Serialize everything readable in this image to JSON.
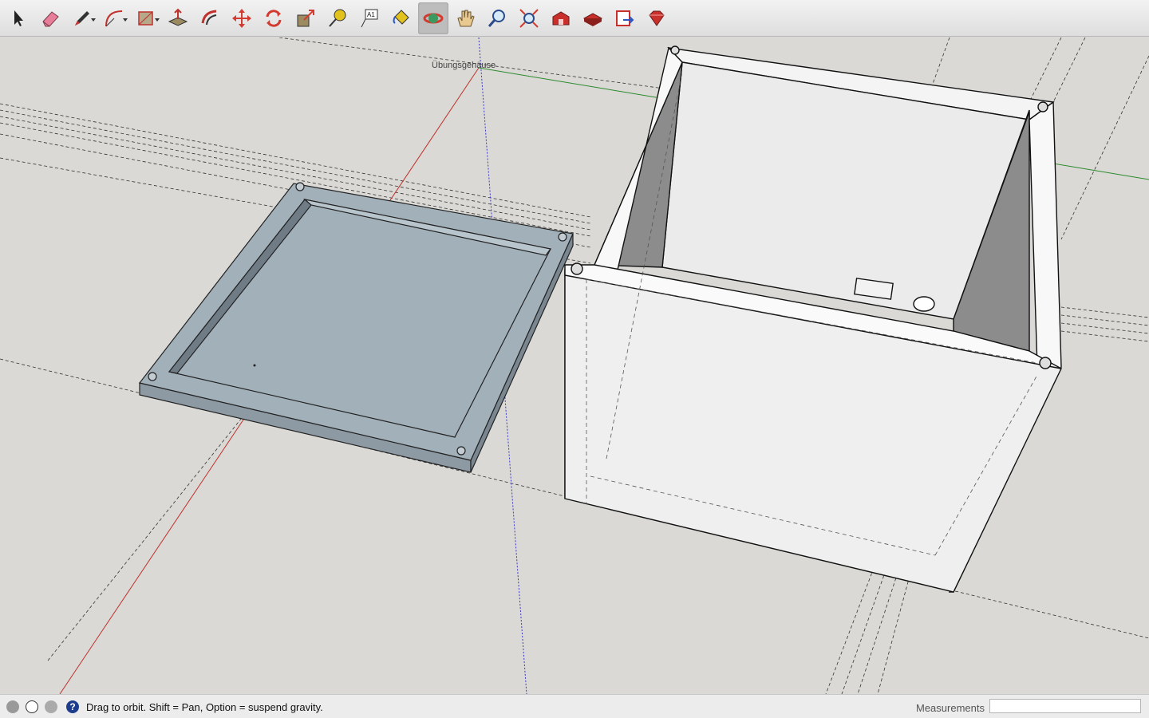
{
  "toolbar": {
    "tools": [
      {
        "name": "Select",
        "icon": "arrow-cursor-icon"
      },
      {
        "name": "Eraser",
        "icon": "eraser-icon"
      },
      {
        "name": "Line",
        "icon": "pencil-icon"
      },
      {
        "name": "Arc",
        "icon": "arc-icon"
      },
      {
        "name": "Rectangle",
        "icon": "rectangle-icon"
      },
      {
        "name": "Push/Pull",
        "icon": "push-pull-icon"
      },
      {
        "name": "Offset",
        "icon": "offset-icon"
      },
      {
        "name": "Move",
        "icon": "move-arrows-icon"
      },
      {
        "name": "Rotate",
        "icon": "rotate-icon"
      },
      {
        "name": "Scale",
        "icon": "scale-icon"
      },
      {
        "name": "Tape Measure",
        "icon": "tape-measure-icon"
      },
      {
        "name": "Text",
        "icon": "text-icon"
      },
      {
        "name": "Paint Bucket",
        "icon": "paint-bucket-icon"
      },
      {
        "name": "Orbit",
        "icon": "orbit-icon",
        "active": true
      },
      {
        "name": "Pan",
        "icon": "hand-pan-icon"
      },
      {
        "name": "Zoom",
        "icon": "magnifier-icon"
      },
      {
        "name": "Zoom Extents",
        "icon": "zoom-extents-icon"
      },
      {
        "name": "3D Warehouse",
        "icon": "warehouse-icon"
      },
      {
        "name": "Extension Warehouse",
        "icon": "extension-warehouse-icon"
      },
      {
        "name": "Send to LayOut",
        "icon": "layout-icon"
      },
      {
        "name": "Extensions",
        "icon": "ruby-icon"
      }
    ],
    "text_tool_glyph": "A1"
  },
  "viewport": {
    "model_label": "Übungsgehäuse",
    "axis_colors": {
      "red": "#c0302c",
      "green": "#2c8a2c",
      "blue": "#3a3ac8"
    },
    "lid_color": "#a2b0ba",
    "box_color": "#f6f6f6"
  },
  "statusbar": {
    "hint": "Drag to orbit.  Shift = Pan, Option = suspend gravity.",
    "measurements_label": "Measurements",
    "measurements_value": ""
  }
}
